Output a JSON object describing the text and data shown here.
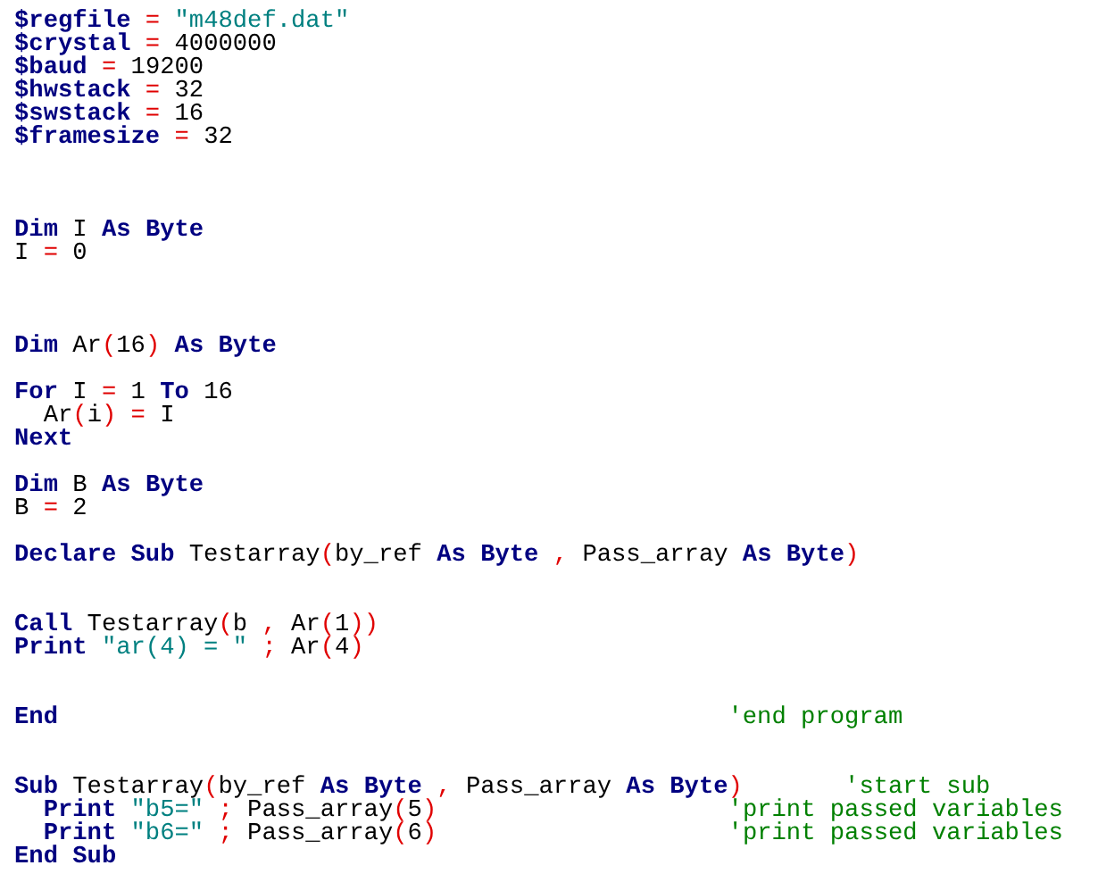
{
  "editor": {
    "lines": [
      {
        "kind": "code",
        "tokens": [
          {
            "kind": "keyword",
            "text": "$regfile"
          },
          {
            "kind": "operator",
            "text": " = "
          },
          {
            "kind": "string",
            "text": "\"m48def.dat\""
          }
        ]
      },
      {
        "kind": "code",
        "tokens": [
          {
            "kind": "keyword",
            "text": "$crystal"
          },
          {
            "kind": "operator",
            "text": " = "
          },
          {
            "kind": "plain",
            "text": "4000000"
          }
        ]
      },
      {
        "kind": "code",
        "tokens": [
          {
            "kind": "keyword",
            "text": "$baud"
          },
          {
            "kind": "operator",
            "text": " = "
          },
          {
            "kind": "plain",
            "text": "19200"
          }
        ]
      },
      {
        "kind": "code",
        "tokens": [
          {
            "kind": "keyword",
            "text": "$hwstack"
          },
          {
            "kind": "operator",
            "text": " = "
          },
          {
            "kind": "plain",
            "text": "32"
          }
        ]
      },
      {
        "kind": "code",
        "tokens": [
          {
            "kind": "keyword",
            "text": "$swstack"
          },
          {
            "kind": "operator",
            "text": " = "
          },
          {
            "kind": "plain",
            "text": "16"
          }
        ]
      },
      {
        "kind": "code",
        "tokens": [
          {
            "kind": "keyword",
            "text": "$framesize"
          },
          {
            "kind": "operator",
            "text": " = "
          },
          {
            "kind": "plain",
            "text": "32"
          }
        ]
      },
      {
        "kind": "blank"
      },
      {
        "kind": "blank"
      },
      {
        "kind": "blank"
      },
      {
        "kind": "code",
        "tokens": [
          {
            "kind": "keyword",
            "text": "Dim"
          },
          {
            "kind": "plain",
            "text": " I "
          },
          {
            "kind": "keyword",
            "text": "As Byte"
          }
        ]
      },
      {
        "kind": "code",
        "tokens": [
          {
            "kind": "plain",
            "text": "I"
          },
          {
            "kind": "operator",
            "text": " = "
          },
          {
            "kind": "plain",
            "text": "0"
          }
        ]
      },
      {
        "kind": "blank"
      },
      {
        "kind": "blank"
      },
      {
        "kind": "blank"
      },
      {
        "kind": "code",
        "tokens": [
          {
            "kind": "keyword",
            "text": "Dim"
          },
          {
            "kind": "plain",
            "text": " Ar"
          },
          {
            "kind": "operator",
            "text": "("
          },
          {
            "kind": "plain",
            "text": "16"
          },
          {
            "kind": "operator",
            "text": ")"
          },
          {
            "kind": "keyword",
            "text": " As Byte"
          }
        ]
      },
      {
        "kind": "blank"
      },
      {
        "kind": "code",
        "tokens": [
          {
            "kind": "keyword",
            "text": "For"
          },
          {
            "kind": "plain",
            "text": " I"
          },
          {
            "kind": "operator",
            "text": " = "
          },
          {
            "kind": "plain",
            "text": "1 "
          },
          {
            "kind": "keyword",
            "text": "To"
          },
          {
            "kind": "plain",
            "text": " 16"
          }
        ]
      },
      {
        "kind": "code",
        "tokens": [
          {
            "kind": "plain",
            "text": "  Ar"
          },
          {
            "kind": "operator",
            "text": "("
          },
          {
            "kind": "plain",
            "text": "i"
          },
          {
            "kind": "operator",
            "text": ") = "
          },
          {
            "kind": "plain",
            "text": "I"
          }
        ]
      },
      {
        "kind": "code",
        "tokens": [
          {
            "kind": "keyword",
            "text": "Next"
          }
        ]
      },
      {
        "kind": "blank"
      },
      {
        "kind": "code",
        "tokens": [
          {
            "kind": "keyword",
            "text": "Dim"
          },
          {
            "kind": "plain",
            "text": " B "
          },
          {
            "kind": "keyword",
            "text": "As Byte"
          }
        ]
      },
      {
        "kind": "code",
        "tokens": [
          {
            "kind": "plain",
            "text": "B"
          },
          {
            "kind": "operator",
            "text": " = "
          },
          {
            "kind": "plain",
            "text": "2"
          }
        ]
      },
      {
        "kind": "blank"
      },
      {
        "kind": "code",
        "tokens": [
          {
            "kind": "keyword",
            "text": "Declare Sub"
          },
          {
            "kind": "plain",
            "text": " Testarray"
          },
          {
            "kind": "operator",
            "text": "("
          },
          {
            "kind": "plain",
            "text": "by_ref "
          },
          {
            "kind": "keyword",
            "text": "As Byte"
          },
          {
            "kind": "operator",
            "text": " , "
          },
          {
            "kind": "plain",
            "text": "Pass_array "
          },
          {
            "kind": "keyword",
            "text": "As Byte"
          },
          {
            "kind": "operator",
            "text": ")"
          }
        ]
      },
      {
        "kind": "blank"
      },
      {
        "kind": "blank"
      },
      {
        "kind": "code",
        "tokens": [
          {
            "kind": "keyword",
            "text": "Call"
          },
          {
            "kind": "plain",
            "text": " Testarray"
          },
          {
            "kind": "operator",
            "text": "("
          },
          {
            "kind": "plain",
            "text": "b"
          },
          {
            "kind": "operator",
            "text": " , "
          },
          {
            "kind": "plain",
            "text": "Ar"
          },
          {
            "kind": "operator",
            "text": "("
          },
          {
            "kind": "plain",
            "text": "1"
          },
          {
            "kind": "operator",
            "text": "))"
          }
        ]
      },
      {
        "kind": "code",
        "tokens": [
          {
            "kind": "keyword",
            "text": "Print"
          },
          {
            "kind": "string",
            "text": " \"ar(4) = \""
          },
          {
            "kind": "operator",
            "text": " ; "
          },
          {
            "kind": "plain",
            "text": "Ar"
          },
          {
            "kind": "operator",
            "text": "("
          },
          {
            "kind": "plain",
            "text": "4"
          },
          {
            "kind": "operator",
            "text": ")"
          }
        ]
      },
      {
        "kind": "blank"
      },
      {
        "kind": "blank"
      },
      {
        "kind": "code",
        "tokens": [
          {
            "kind": "keyword",
            "text": "End"
          },
          {
            "kind": "comment",
            "text": "                                              'end program"
          }
        ]
      },
      {
        "kind": "blank"
      },
      {
        "kind": "blank"
      },
      {
        "kind": "code",
        "tokens": [
          {
            "kind": "keyword",
            "text": "Sub"
          },
          {
            "kind": "plain",
            "text": " Testarray"
          },
          {
            "kind": "operator",
            "text": "("
          },
          {
            "kind": "plain",
            "text": "by_ref "
          },
          {
            "kind": "keyword",
            "text": "As Byte"
          },
          {
            "kind": "operator",
            "text": " , "
          },
          {
            "kind": "plain",
            "text": "Pass_array "
          },
          {
            "kind": "keyword",
            "text": "As Byte"
          },
          {
            "kind": "operator",
            "text": ")"
          },
          {
            "kind": "comment",
            "text": "       'start sub"
          }
        ]
      },
      {
        "kind": "code",
        "tokens": [
          {
            "kind": "keyword",
            "text": "  Print"
          },
          {
            "kind": "string",
            "text": " \"b5=\""
          },
          {
            "kind": "operator",
            "text": " ; "
          },
          {
            "kind": "plain",
            "text": "Pass_array"
          },
          {
            "kind": "operator",
            "text": "("
          },
          {
            "kind": "plain",
            "text": "5"
          },
          {
            "kind": "operator",
            "text": ")"
          },
          {
            "kind": "comment",
            "text": "                    'print passed variables"
          }
        ]
      },
      {
        "kind": "code",
        "tokens": [
          {
            "kind": "keyword",
            "text": "  Print"
          },
          {
            "kind": "string",
            "text": " \"b6=\""
          },
          {
            "kind": "operator",
            "text": " ; "
          },
          {
            "kind": "plain",
            "text": "Pass_array"
          },
          {
            "kind": "operator",
            "text": "("
          },
          {
            "kind": "plain",
            "text": "6"
          },
          {
            "kind": "operator",
            "text": ")"
          },
          {
            "kind": "comment",
            "text": "                    'print passed variables"
          }
        ]
      },
      {
        "kind": "code",
        "tokens": [
          {
            "kind": "keyword",
            "text": "End Sub"
          }
        ]
      }
    ]
  }
}
